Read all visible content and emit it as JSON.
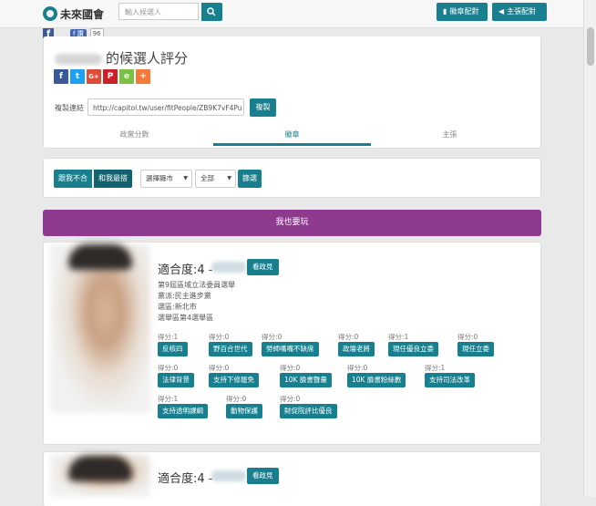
{
  "header": {
    "logo_text": "未來國會",
    "search_placeholder": "輸入候選人",
    "btn_issue_match": "徽章配對",
    "btn_policy_match": "主張配對"
  },
  "fb": {
    "icon": "f",
    "like": "讚",
    "count": "96"
  },
  "candidate_panel": {
    "title_suffix": "的候選人評分",
    "copy_label": "複製連結",
    "copy_url": "http://capitol.tw/user/fitPeople/ZB9K7vF4Pu",
    "copy_button": "複製",
    "share": [
      "f",
      "t",
      "G+",
      "P",
      "e",
      "+"
    ],
    "tabs": [
      {
        "label": "政黨分數",
        "active": false
      },
      {
        "label": "徽章",
        "active": true
      },
      {
        "label": "主張",
        "active": false
      }
    ]
  },
  "filter": {
    "seg_disagree": "跟我不合",
    "seg_agree": "和我最搭",
    "county_select": "選擇縣市",
    "all_select": "全部",
    "filter_button": "篩選"
  },
  "play_bar": "我也要玩",
  "cards": [
    {
      "fit": "適合度:4 -",
      "see_button": "看政見",
      "info": [
        "第9屆區域立法委員選舉",
        "黨派:民主進步黨",
        "選區:新北市",
        "選舉區第4選舉區"
      ],
      "tag_rows": [
        [
          {
            "score": "得分:1",
            "tag": "反核四"
          },
          {
            "score": "得分:0",
            "tag": "野百合世代"
          },
          {
            "score": "得分:0",
            "tag": "勞師嘴嘴不缺席"
          },
          {
            "score": "得分:0",
            "tag": "政壇老將"
          },
          {
            "score": "得分:1",
            "tag": "現任優良立委"
          },
          {
            "score": "得分:0",
            "tag": "現任立委"
          }
        ],
        [
          {
            "score": "得分:0",
            "tag": "法律背景"
          },
          {
            "score": "得分:0",
            "tag": "支持下修罷免"
          },
          {
            "score": "得分:0",
            "tag": "10K 臉書聲量"
          },
          {
            "score": "得分:0",
            "tag": "10K 臉書粉絲數"
          },
          {
            "score": "得分:1",
            "tag": "支持司法改革"
          }
        ],
        [
          {
            "score": "得分:1",
            "tag": "支持透明課綱"
          },
          {
            "score": "得分:0",
            "tag": "動物保護"
          },
          {
            "score": "得分:0",
            "tag": "財促院評比優良"
          }
        ]
      ]
    },
    {
      "fit": "適合度:4 -",
      "see_button": "看政見"
    }
  ]
}
